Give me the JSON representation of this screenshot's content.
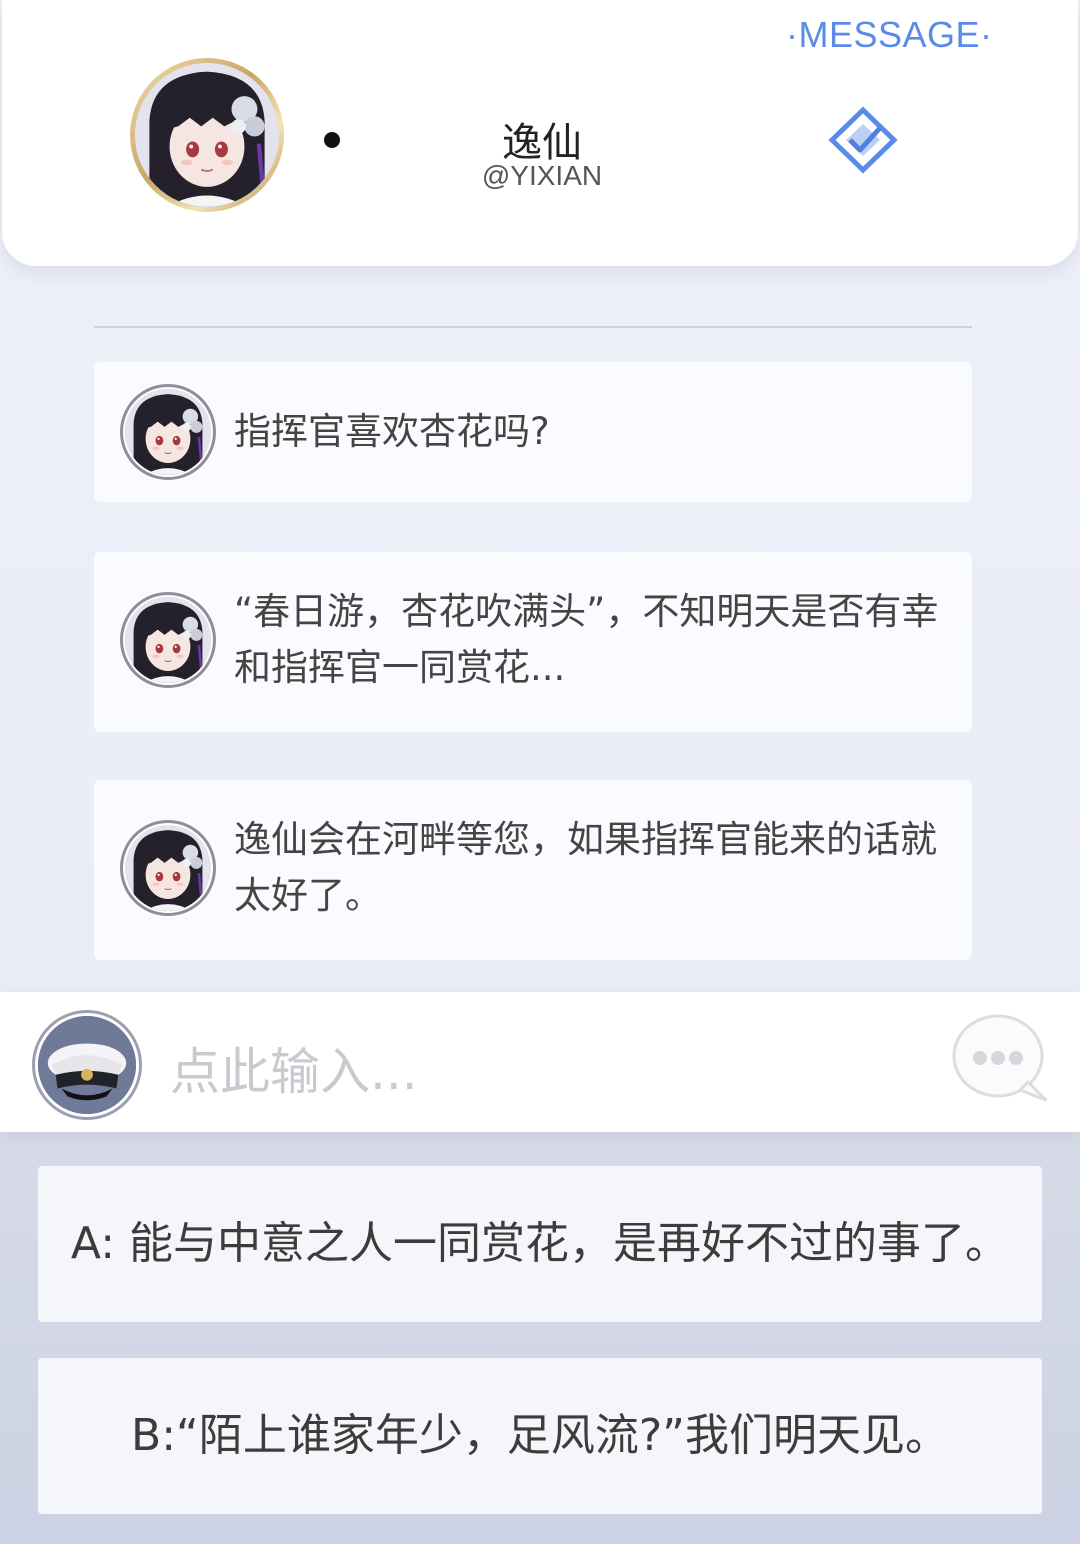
{
  "header": {
    "message_label": "·MESSAGE·",
    "name": "逸仙",
    "handle": "@YIXIAN",
    "avatar_icon": "yixian-avatar",
    "verify_icon": "verified-diamond-icon",
    "accent_color": "#5b8be8"
  },
  "messages": [
    {
      "text": "指挥官喜欢杏花吗?"
    },
    {
      "text": "“春日游，杏花吹满头”，不知明天是否有幸和指挥官一同赏花..."
    },
    {
      "text": "逸仙会在河畔等您，如果指挥官能来的话就太好了。"
    }
  ],
  "input": {
    "placeholder": "点此输入...",
    "user_avatar_icon": "commander-cap-avatar",
    "chat_icon": "chat-bubble-icon"
  },
  "options": [
    {
      "label": "A: 能与中意之人一同赏花，是再好不过的事了。"
    },
    {
      "label": "B:“陌上谁家年少，足风流?”我们明天见。"
    }
  ]
}
